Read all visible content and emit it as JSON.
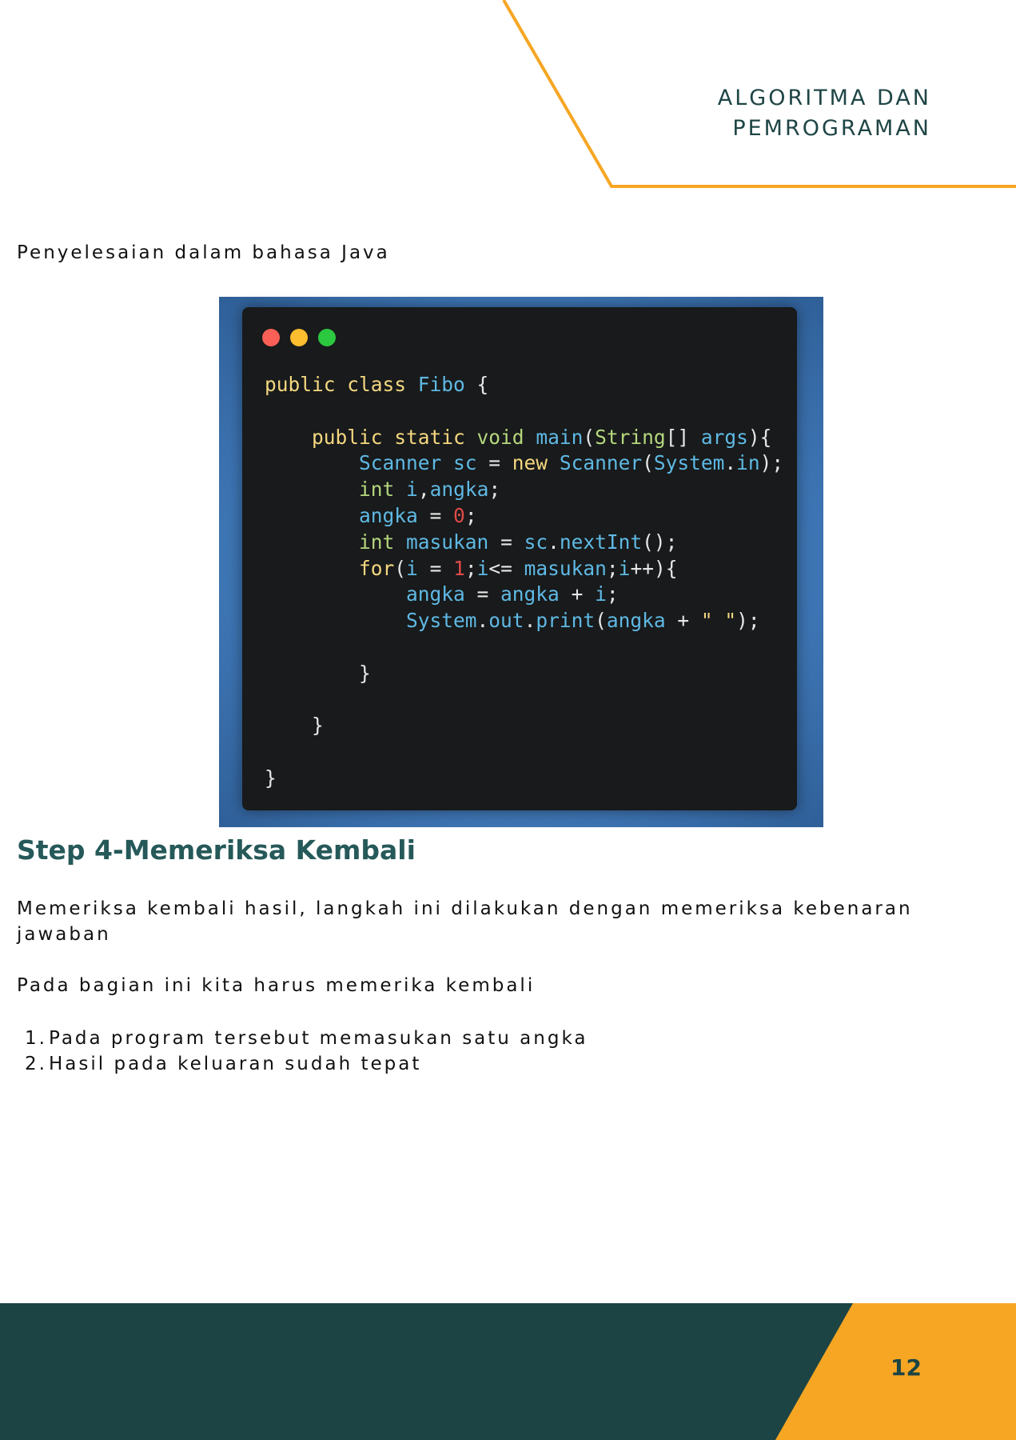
{
  "header": {
    "title_line1": "ALGORITMA DAN",
    "title_line2": "PEMROGRAMAN"
  },
  "intro": "Penyelesaian dalam bahasa Java",
  "code_window": {
    "dots": [
      "red",
      "yellow",
      "green"
    ]
  },
  "step": {
    "title": "Step 4-Memeriksa Kembali",
    "paragraph1": "Memeriksa kembali hasil, langkah ini dilakukan dengan memeriksa kebenaran jawaban",
    "paragraph2": "Pada bagian ini kita harus memerika kembali",
    "list": [
      {
        "num": "1.",
        "text": "Pada program tersebut memasukan satu angka"
      },
      {
        "num": "2.",
        "text": "Hasil pada keluaran sudah tepat"
      }
    ]
  },
  "footer": {
    "page_number": "12"
  },
  "colors": {
    "accent_orange": "#f6a623",
    "dark_teal": "#1d4444",
    "title_teal": "#265959"
  }
}
